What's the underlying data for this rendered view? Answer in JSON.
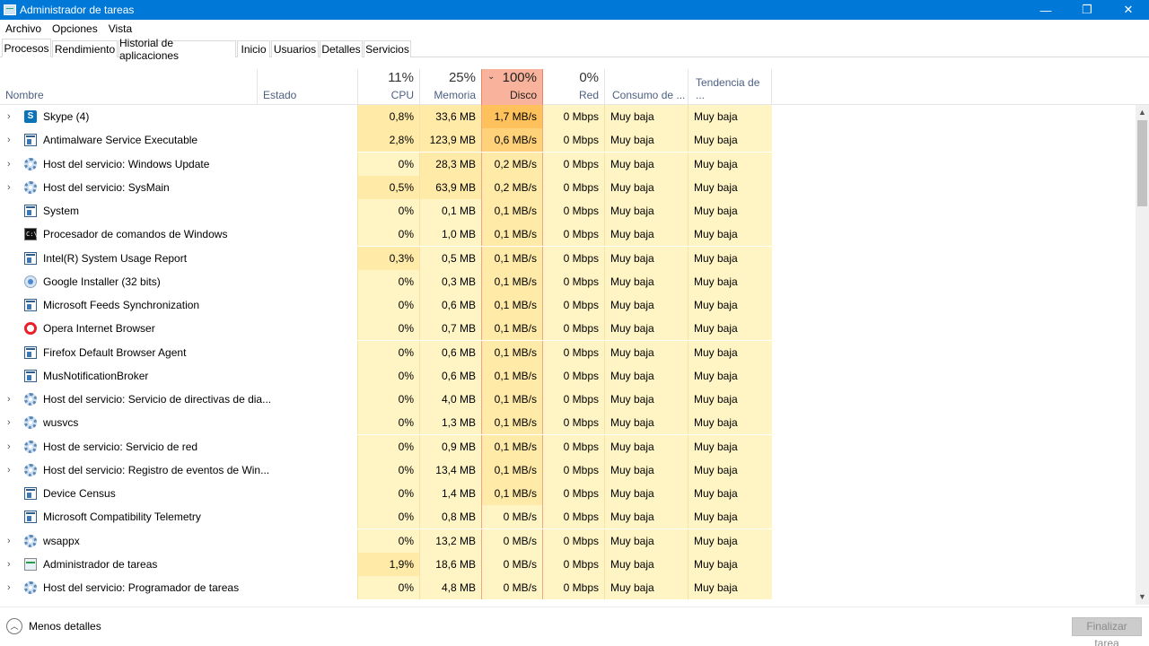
{
  "window": {
    "title": "Administrador de tareas",
    "minimize": "—",
    "maximize": "❐",
    "close": "✕"
  },
  "menu": [
    "Archivo",
    "Opciones",
    "Vista"
  ],
  "tabs": [
    "Procesos",
    "Rendimiento",
    "Historial de aplicaciones",
    "Inicio",
    "Usuarios",
    "Detalles",
    "Servicios"
  ],
  "active_tab": "Procesos",
  "columns": {
    "name": {
      "label": "Nombre"
    },
    "status": {
      "label": "Estado"
    },
    "cpu": {
      "label": "CPU",
      "pct": "11%"
    },
    "memory": {
      "label": "Memoria",
      "pct": "25%"
    },
    "disk": {
      "label": "Disco",
      "pct": "100%",
      "sort_icon": "⌄"
    },
    "network": {
      "label": "Red",
      "pct": "0%"
    },
    "power": {
      "label": "Consumo de ..."
    },
    "trend": {
      "label": "Tendencia de ..."
    }
  },
  "processes": [
    {
      "name": "Skype (4)",
      "icon": "skype-icon",
      "expand": true,
      "cpu": "0,8%",
      "mem": "33,6 MB",
      "disk": "1,7 MB/s",
      "net": "0 Mbps",
      "power": "Muy baja",
      "trend": "Muy baja",
      "cpu_heat": 1,
      "mem_heat": 1,
      "disk_heat": 3
    },
    {
      "name": "Antimalware Service Executable",
      "icon": "window-icon",
      "expand": true,
      "cpu": "2,8%",
      "mem": "123,9 MB",
      "disk": "0,6 MB/s",
      "net": "0 Mbps",
      "power": "Muy baja",
      "trend": "Muy baja",
      "cpu_heat": 1,
      "mem_heat": 1,
      "disk_heat": 2
    },
    {
      "name": "Host del servicio: Windows Update",
      "icon": "gear-icon",
      "expand": true,
      "cpu": "0%",
      "mem": "28,3 MB",
      "disk": "0,2 MB/s",
      "net": "0 Mbps",
      "power": "Muy baja",
      "trend": "Muy baja",
      "cpu_heat": 0,
      "mem_heat": 1,
      "disk_heat": 1
    },
    {
      "name": "Host del servicio: SysMain",
      "icon": "gear-icon",
      "expand": true,
      "cpu": "0,5%",
      "mem": "63,9 MB",
      "disk": "0,2 MB/s",
      "net": "0 Mbps",
      "power": "Muy baja",
      "trend": "Muy baja",
      "cpu_heat": 1,
      "mem_heat": 1,
      "disk_heat": 1
    },
    {
      "name": "System",
      "icon": "window-icon",
      "expand": false,
      "cpu": "0%",
      "mem": "0,1 MB",
      "disk": "0,1 MB/s",
      "net": "0 Mbps",
      "power": "Muy baja",
      "trend": "Muy baja",
      "cpu_heat": 0,
      "mem_heat": 0,
      "disk_heat": 1
    },
    {
      "name": "Procesador de comandos de Windows",
      "icon": "cmd-icon",
      "expand": false,
      "cpu": "0%",
      "mem": "1,0 MB",
      "disk": "0,1 MB/s",
      "net": "0 Mbps",
      "power": "Muy baja",
      "trend": "Muy baja",
      "cpu_heat": 0,
      "mem_heat": 0,
      "disk_heat": 1
    },
    {
      "name": "Intel(R) System Usage Report",
      "icon": "window-icon",
      "expand": false,
      "cpu": "0,3%",
      "mem": "0,5 MB",
      "disk": "0,1 MB/s",
      "net": "0 Mbps",
      "power": "Muy baja",
      "trend": "Muy baja",
      "cpu_heat": 1,
      "mem_heat": 0,
      "disk_heat": 1
    },
    {
      "name": "Google Installer (32 bits)",
      "icon": "installer-icon",
      "expand": false,
      "cpu": "0%",
      "mem": "0,3 MB",
      "disk": "0,1 MB/s",
      "net": "0 Mbps",
      "power": "Muy baja",
      "trend": "Muy baja",
      "cpu_heat": 0,
      "mem_heat": 0,
      "disk_heat": 1
    },
    {
      "name": "Microsoft Feeds Synchronization",
      "icon": "window-icon",
      "expand": false,
      "cpu": "0%",
      "mem": "0,6 MB",
      "disk": "0,1 MB/s",
      "net": "0 Mbps",
      "power": "Muy baja",
      "trend": "Muy baja",
      "cpu_heat": 0,
      "mem_heat": 0,
      "disk_heat": 1
    },
    {
      "name": "Opera Internet Browser",
      "icon": "opera-icon",
      "expand": false,
      "cpu": "0%",
      "mem": "0,7 MB",
      "disk": "0,1 MB/s",
      "net": "0 Mbps",
      "power": "Muy baja",
      "trend": "Muy baja",
      "cpu_heat": 0,
      "mem_heat": 0,
      "disk_heat": 1
    },
    {
      "name": "Firefox Default Browser Agent",
      "icon": "window-icon",
      "expand": false,
      "cpu": "0%",
      "mem": "0,6 MB",
      "disk": "0,1 MB/s",
      "net": "0 Mbps",
      "power": "Muy baja",
      "trend": "Muy baja",
      "cpu_heat": 0,
      "mem_heat": 0,
      "disk_heat": 1
    },
    {
      "name": "MusNotificationBroker",
      "icon": "window-icon",
      "expand": false,
      "cpu": "0%",
      "mem": "0,6 MB",
      "disk": "0,1 MB/s",
      "net": "0 Mbps",
      "power": "Muy baja",
      "trend": "Muy baja",
      "cpu_heat": 0,
      "mem_heat": 0,
      "disk_heat": 1
    },
    {
      "name": "Host del servicio: Servicio de directivas de dia...",
      "icon": "gear-icon",
      "expand": true,
      "cpu": "0%",
      "mem": "4,0 MB",
      "disk": "0,1 MB/s",
      "net": "0 Mbps",
      "power": "Muy baja",
      "trend": "Muy baja",
      "cpu_heat": 0,
      "mem_heat": 0,
      "disk_heat": 1
    },
    {
      "name": "wusvcs",
      "icon": "gear-icon",
      "expand": true,
      "cpu": "0%",
      "mem": "1,3 MB",
      "disk": "0,1 MB/s",
      "net": "0 Mbps",
      "power": "Muy baja",
      "trend": "Muy baja",
      "cpu_heat": 0,
      "mem_heat": 0,
      "disk_heat": 1
    },
    {
      "name": "Host de servicio: Servicio de red",
      "icon": "gear-icon",
      "expand": true,
      "cpu": "0%",
      "mem": "0,9 MB",
      "disk": "0,1 MB/s",
      "net": "0 Mbps",
      "power": "Muy baja",
      "trend": "Muy baja",
      "cpu_heat": 0,
      "mem_heat": 0,
      "disk_heat": 1
    },
    {
      "name": "Host del servicio: Registro de eventos de Win...",
      "icon": "gear-icon",
      "expand": true,
      "cpu": "0%",
      "mem": "13,4 MB",
      "disk": "0,1 MB/s",
      "net": "0 Mbps",
      "power": "Muy baja",
      "trend": "Muy baja",
      "cpu_heat": 0,
      "mem_heat": 0,
      "disk_heat": 1
    },
    {
      "name": "Device Census",
      "icon": "window-icon",
      "expand": false,
      "cpu": "0%",
      "mem": "1,4 MB",
      "disk": "0,1 MB/s",
      "net": "0 Mbps",
      "power": "Muy baja",
      "trend": "Muy baja",
      "cpu_heat": 0,
      "mem_heat": 0,
      "disk_heat": 1
    },
    {
      "name": "Microsoft Compatibility Telemetry",
      "icon": "window-icon",
      "expand": false,
      "cpu": "0%",
      "mem": "0,8 MB",
      "disk": "0 MB/s",
      "net": "0 Mbps",
      "power": "Muy baja",
      "trend": "Muy baja",
      "cpu_heat": 0,
      "mem_heat": 0,
      "disk_heat": 0
    },
    {
      "name": "wsappx",
      "icon": "gear-icon",
      "expand": true,
      "cpu": "0%",
      "mem": "13,2 MB",
      "disk": "0 MB/s",
      "net": "0 Mbps",
      "power": "Muy baja",
      "trend": "Muy baja",
      "cpu_heat": 0,
      "mem_heat": 0,
      "disk_heat": 0
    },
    {
      "name": "Administrador de tareas",
      "icon": "taskmgr-icon",
      "expand": true,
      "cpu": "1,9%",
      "mem": "18,6 MB",
      "disk": "0 MB/s",
      "net": "0 Mbps",
      "power": "Muy baja",
      "trend": "Muy baja",
      "cpu_heat": 1,
      "mem_heat": 0,
      "disk_heat": 0
    },
    {
      "name": "Host del servicio: Programador de tareas",
      "icon": "gear-icon",
      "expand": true,
      "cpu": "0%",
      "mem": "4,8 MB",
      "disk": "0 MB/s",
      "net": "0 Mbps",
      "power": "Muy baja",
      "trend": "Muy baja",
      "cpu_heat": 0,
      "mem_heat": 0,
      "disk_heat": 0
    }
  ],
  "colors": {
    "titlebar": "#0078d7",
    "heat0": "#fff4c4",
    "heat1": "#ffeaa8",
    "heat2": "#ffd27a",
    "heat3": "#ffc15c",
    "disk_header": "#f9b29b"
  },
  "footer": {
    "less_details": "Menos detalles",
    "end_task": "Finalizar tarea"
  }
}
